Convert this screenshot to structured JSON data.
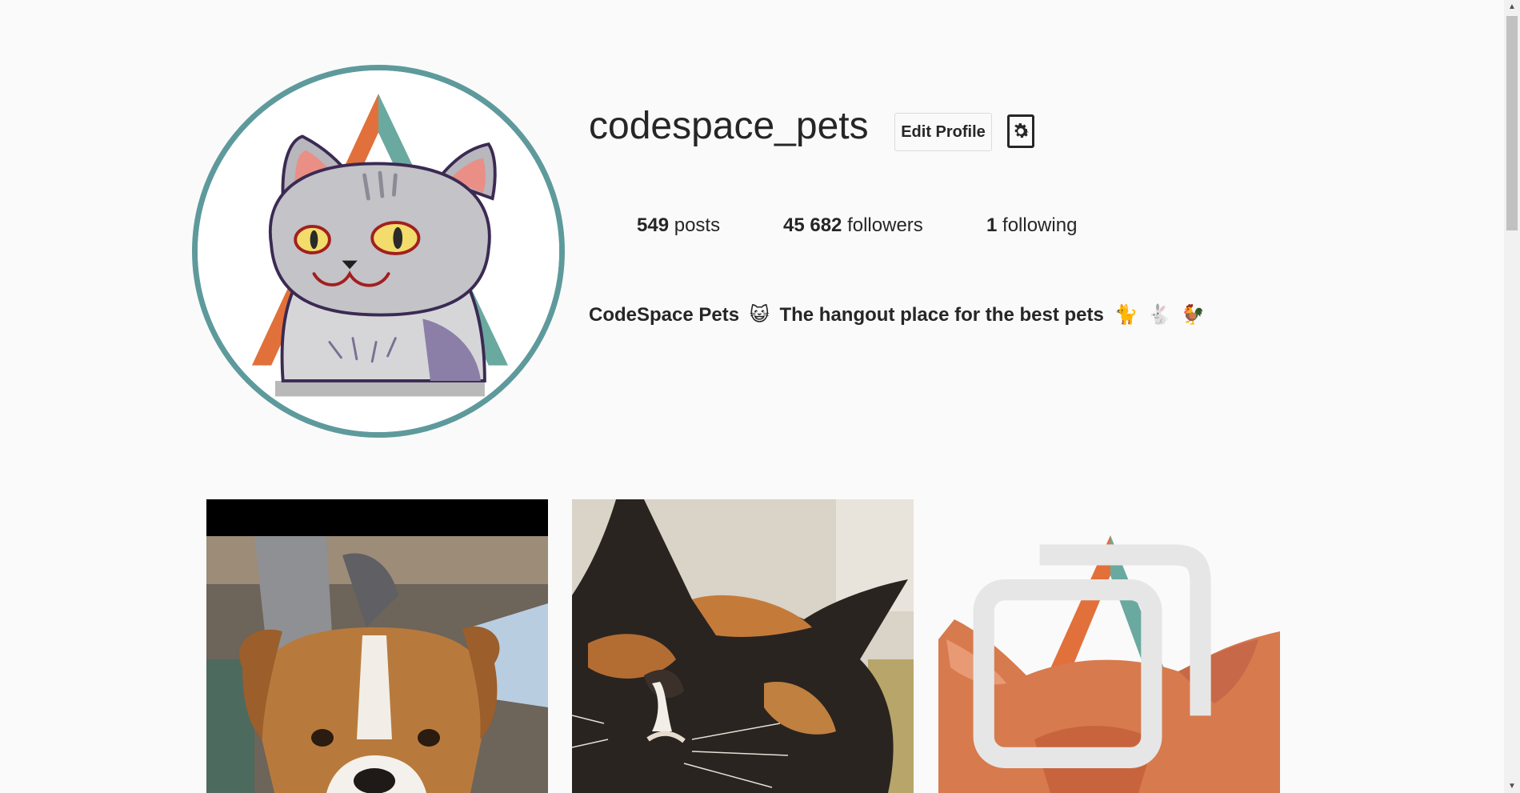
{
  "profile": {
    "username": "codespace_pets",
    "edit_button": "Edit Profile",
    "settings_icon": "gear-icon",
    "avatar_icon": "cat-logo-icon"
  },
  "stats": [
    {
      "count": "549",
      "label": "posts"
    },
    {
      "count": "45 682",
      "label": "followers"
    },
    {
      "count": "1",
      "label": "following"
    }
  ],
  "bio": {
    "name": "CodeSpace Pets",
    "emoji1": "😺",
    "text": "The hangout place for the best pets",
    "emoji2": "🐈",
    "emoji3": "🐇",
    "emoji4": "🐓"
  },
  "posts": [
    {
      "subject": "dog-photo",
      "multiple": false
    },
    {
      "subject": "calico-cat-photo",
      "multiple": false
    },
    {
      "subject": "orange-cat-logo-photo",
      "multiple": true,
      "icon": "multiple-images-icon"
    }
  ],
  "colors": {
    "accent_teal": "#5e9a9c",
    "accent_orange": "#e2703a",
    "background": "#fafafa"
  }
}
